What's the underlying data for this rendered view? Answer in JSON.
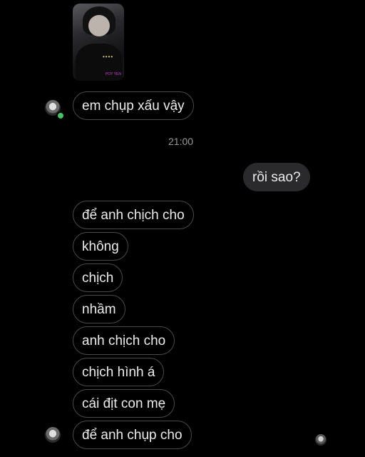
{
  "photo": {
    "dots": "••••",
    "tag": "POY YEN"
  },
  "messages": [
    {
      "text": "em chụp xấu vậy"
    },
    {
      "text": "rồi sao?"
    },
    {
      "text": "để anh chịch cho"
    },
    {
      "text": "không"
    },
    {
      "text": "chịch"
    },
    {
      "text": "nhầm"
    },
    {
      "text": "anh chịch cho"
    },
    {
      "text": "chịch hình á"
    },
    {
      "text": "cái địt con mẹ"
    },
    {
      "text": "để anh chụp cho"
    }
  ],
  "timestamp": "21:00",
  "colors": {
    "background": "#000000",
    "incoming_border": "#4a4a4a",
    "outgoing_bubble": "#2a2a2c",
    "online": "#44c265"
  }
}
